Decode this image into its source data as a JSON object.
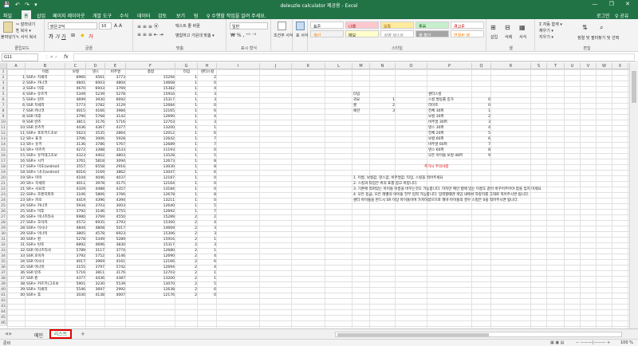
{
  "titlebar": {
    "quick_access": "💾 ↶ ↷ ▾",
    "title": "deleuzle calculator 제공용 - Excel",
    "controls": "— ❐ ✕"
  },
  "menu": {
    "items": [
      "파일",
      "홈",
      "삽입",
      "페이지 레이아웃",
      "개발 도구",
      "수식",
      "데이터",
      "검토",
      "보기",
      "팀",
      "♀ 수행할 작업을 알려 주세요."
    ],
    "right": [
      "로그인",
      "♀ 공유"
    ]
  },
  "ribbon": {
    "clipboard": {
      "paste": "붙여넣기",
      "cut": "✂ 잘라내기",
      "copy": "⎘ 복사 ▾",
      "format_painter": "✎ 서식 복사",
      "label": "클립보드"
    },
    "font": {
      "name": "맑은고딕",
      "size": "10",
      "label": "글꼴"
    },
    "align": {
      "wrap": "텍스트 줄 바꿈",
      "merge": "병합하고 가운데 맞춤 ▾",
      "label": "맞춤"
    },
    "number": {
      "format": "일반",
      "label": "표시 형식"
    },
    "cond": {
      "conditional": "조건부 서식",
      "table": "표 서식"
    },
    "styles": {
      "cells": [
        "표준",
        "나쁨",
        "보통",
        "좋음",
        "경고문",
        "계산",
        "메모",
        "설명 텍스트",
        "셀 확인",
        "연결된 셀"
      ],
      "label": "스타일"
    },
    "cells_group": {
      "insert": "삽입",
      "delete": "삭제",
      "format": "서식",
      "label": "셀"
    },
    "editing": {
      "autosum": "Σ 자동 합계 ▾",
      "fill": "채우기 ▾",
      "clear": "지우기 ▾",
      "sort": "정렬 및 필터",
      "find": "찾기 및 선택",
      "label": "편집"
    }
  },
  "formula_bar": {
    "name_box": "G11",
    "fx": "fx",
    "value": ""
  },
  "columns": [
    "A",
    "B",
    "C",
    "D",
    "E",
    "F",
    "G",
    "H",
    "I",
    "J",
    "K",
    "L",
    "M",
    "N",
    "O",
    "P",
    "Q",
    "R",
    "S",
    "T",
    "U",
    "V",
    "W",
    "X"
  ],
  "headers": [
    "이름",
    "보컬",
    "댄스",
    "비주얼",
    "총합",
    "타입",
    "센터스킬"
  ],
  "rows": [
    [
      "1",
      "SSR+ 치세리",
      "6960",
      "4561",
      "3773",
      "15294",
      "1",
      "2"
    ],
    [
      "2",
      "SSR+ 카나코",
      "4841",
      "6003",
      "4804",
      "14668",
      "1",
      "0"
    ],
    [
      "3",
      "SSR+ 미후",
      "4670",
      "6943",
      "3769",
      "15382",
      "1",
      "4"
    ],
    [
      "4",
      "SSR+ 유즈키",
      "5349",
      "5239",
      "5278",
      "15916",
      "1",
      "3"
    ],
    [
      "5",
      "SSR+ 란즈",
      "4699",
      "3930",
      "6692",
      "15317",
      "1",
      "3"
    ],
    [
      "6",
      "SSR 치세리",
      "5773",
      "3782",
      "3129",
      "12684",
      "1",
      "0"
    ],
    [
      "7",
      "SSR 카나코",
      "4015",
      "4166",
      "3984",
      "12165",
      "1",
      "6"
    ],
    [
      "8",
      "SSR 미후",
      "3790",
      "5768",
      "3142",
      "12690",
      "1",
      "4"
    ],
    [
      "9",
      "SSR 란즈",
      "3811",
      "3176",
      "5716",
      "12703",
      "1",
      "3"
    ],
    [
      "10",
      "SSR 유즈키",
      "4436",
      "4367",
      "4377",
      "13200",
      "1",
      "1"
    ],
    [
      "11",
      "SSR+ 포토키드초보",
      "5623",
      "3535",
      "2864",
      "12012",
      "1",
      "6"
    ],
    [
      "12",
      "SR+ 표코",
      "3706",
      "3006",
      "5928",
      "12642",
      "1",
      "7"
    ],
    [
      "13",
      "SR+ 유키",
      "3136",
      "3786",
      "5767",
      "12689",
      "1",
      "7"
    ],
    [
      "14",
      "SR+ 아즈키",
      "4272",
      "3388",
      "3533",
      "11193",
      "1",
      "0"
    ],
    [
      "15",
      "SSR+ 유키데그초보",
      "4323",
      "4402",
      "4803",
      "13528",
      "1",
      "5"
    ],
    [
      "16",
      "SSR+ 시키",
      "3761",
      "5818",
      "3094",
      "12673",
      "1",
      "8"
    ],
    [
      "17",
      "SSR+ 미호(android",
      "3557",
      "6558",
      "2916",
      "13030",
      "1",
      "8"
    ],
    [
      "18",
      "SSR+ 나나(android",
      "6016",
      "3169",
      "3862",
      "13047",
      "1",
      "6"
    ],
    [
      "19",
      "SR+ 미미",
      "4104",
      "4046",
      "4037",
      "12187",
      "1",
      "0"
    ],
    [
      "20",
      "SR+ 치세리",
      "4011",
      "3978",
      "4175",
      "12164",
      "1",
      "0"
    ],
    [
      "21",
      "SR+ 사요리",
      "4329",
      "4488",
      "4357",
      "13184",
      "1",
      "0"
    ],
    [
      "22",
      "SSR+ 조렌지피카",
      "3106",
      "5806",
      "3766",
      "12678",
      "1",
      "8"
    ],
    [
      "23",
      "SR+ 카호",
      "4419",
      "4396",
      "4394",
      "13211",
      "1",
      "0"
    ],
    [
      "24",
      "SSR+ 카나코",
      "5934",
      "3703",
      "3003",
      "12640",
      "1",
      "5"
    ],
    [
      "25",
      "SSR+ 미후",
      "3792",
      "3146",
      "5755",
      "12692",
      "1",
      "7"
    ],
    [
      "26",
      "SSR+ 이나즈타사",
      "6980",
      "3769",
      "4550",
      "15289",
      "2",
      "2"
    ],
    [
      "27",
      "SSR+ 호이카",
      "4572",
      "6935",
      "3793",
      "15300",
      "2",
      "4"
    ],
    [
      "28",
      "SSR+ 이시나",
      "4844",
      "4808",
      "5017",
      "14669",
      "2",
      "3"
    ],
    [
      "29",
      "SSR+ 이나미",
      "3805",
      "4578",
      "6923",
      "15306",
      "2",
      "3"
    ],
    [
      "30",
      "SSR+ 핀",
      "5278",
      "5349",
      "5289",
      "15916",
      "2",
      "1"
    ],
    [
      "31",
      "SSR+ 탄조",
      "6892",
      "4696",
      "3830",
      "15317",
      "2",
      "3"
    ],
    [
      "32",
      "SSR 이나츠타사",
      "5789",
      "3117",
      "3774",
      "12680",
      "2",
      "1"
    ],
    [
      "33",
      "SSR 호이카",
      "3792",
      "5752",
      "3146",
      "12690",
      "2",
      "4"
    ],
    [
      "34",
      "SSR 이시나",
      "4017",
      "3969",
      "4161",
      "12166",
      "2",
      "6"
    ],
    [
      "35",
      "SSR 이나미",
      "3155",
      "3797",
      "5742",
      "12694",
      "2",
      "4"
    ],
    [
      "36",
      "SSR 탄조",
      "5716",
      "3811",
      "3176",
      "12703",
      "2",
      "1"
    ],
    [
      "37",
      "SSR 핀",
      "4377",
      "4436",
      "4387",
      "13200",
      "2",
      "1"
    ],
    [
      "38",
      "SSR+ 카즈키(그초보",
      "5901",
      "3230",
      "5539",
      "13070",
      "2",
      "5"
    ],
    [
      "39",
      "SSR+ 치세리",
      "5546",
      "3697",
      "2992",
      "12638",
      "2",
      "6"
    ],
    [
      "40",
      "SSR+ 후",
      "3030",
      "4138",
      "4007",
      "12176",
      "2",
      "0"
    ]
  ],
  "info_table": {
    "type_header": "타입",
    "types": [
      [
        "귀요",
        "1"
      ],
      [
        "쿨",
        "2"
      ],
      [
        "패션",
        "3"
      ]
    ],
    "skill_header": "센터스킬",
    "skills": [
      [
        "스킬 발동률 증가",
        "0"
      ],
      [
        "라이프",
        "0"
      ],
      [
        "전체 30퍼",
        "1"
      ],
      [
        "보컬 30퍼",
        "2"
      ],
      [
        "비주얼 30퍼",
        "3"
      ],
      [
        "댄스 30퍼",
        "4"
      ],
      [
        "전체 20퍼",
        "5"
      ],
      [
        "보컬 60퍼",
        "6"
      ],
      [
        "비주얼 60퍼",
        "7"
      ],
      [
        "댄스 60퍼",
        "8"
      ],
      [
        "모든 아이돌 보컬 48퍼",
        "9"
      ]
    ]
  },
  "notes": {
    "title": "추가시 주의사항",
    "lines": [
      "1. 이름, 보컬값, 댄스값, 비주얼값, 타입, 스킬을 적어주세요",
      "2. 스킬과 타입은 위의 표를 참고 바랍니다.",
      "3. 기존에 적혀있는 아이돌 이름을 바꾸는것도 가능합니다. 하지만 메인 탭에 있는 이름도 같이 바꾸어주어야 함을 잊지 마세요",
      "4. 모든 등급, 모든 레벨의 아이돌 전부 입력 가능합니다. 입력할떄엔 게임 내에서 자랑치를 그대로 적어주시면 됩니다.",
      "   센터 아이돌을 반드시 SR 이상 아이돌이며 가챠하셨으므로 해야 아이돌의 경우 스킬은 0을 적어주시면 됩니다."
    ]
  },
  "tabs": {
    "items": [
      "메인",
      "리스트"
    ],
    "active": 1,
    "add": "+"
  },
  "status": {
    "left": "준비",
    "zoom": "100 %"
  }
}
